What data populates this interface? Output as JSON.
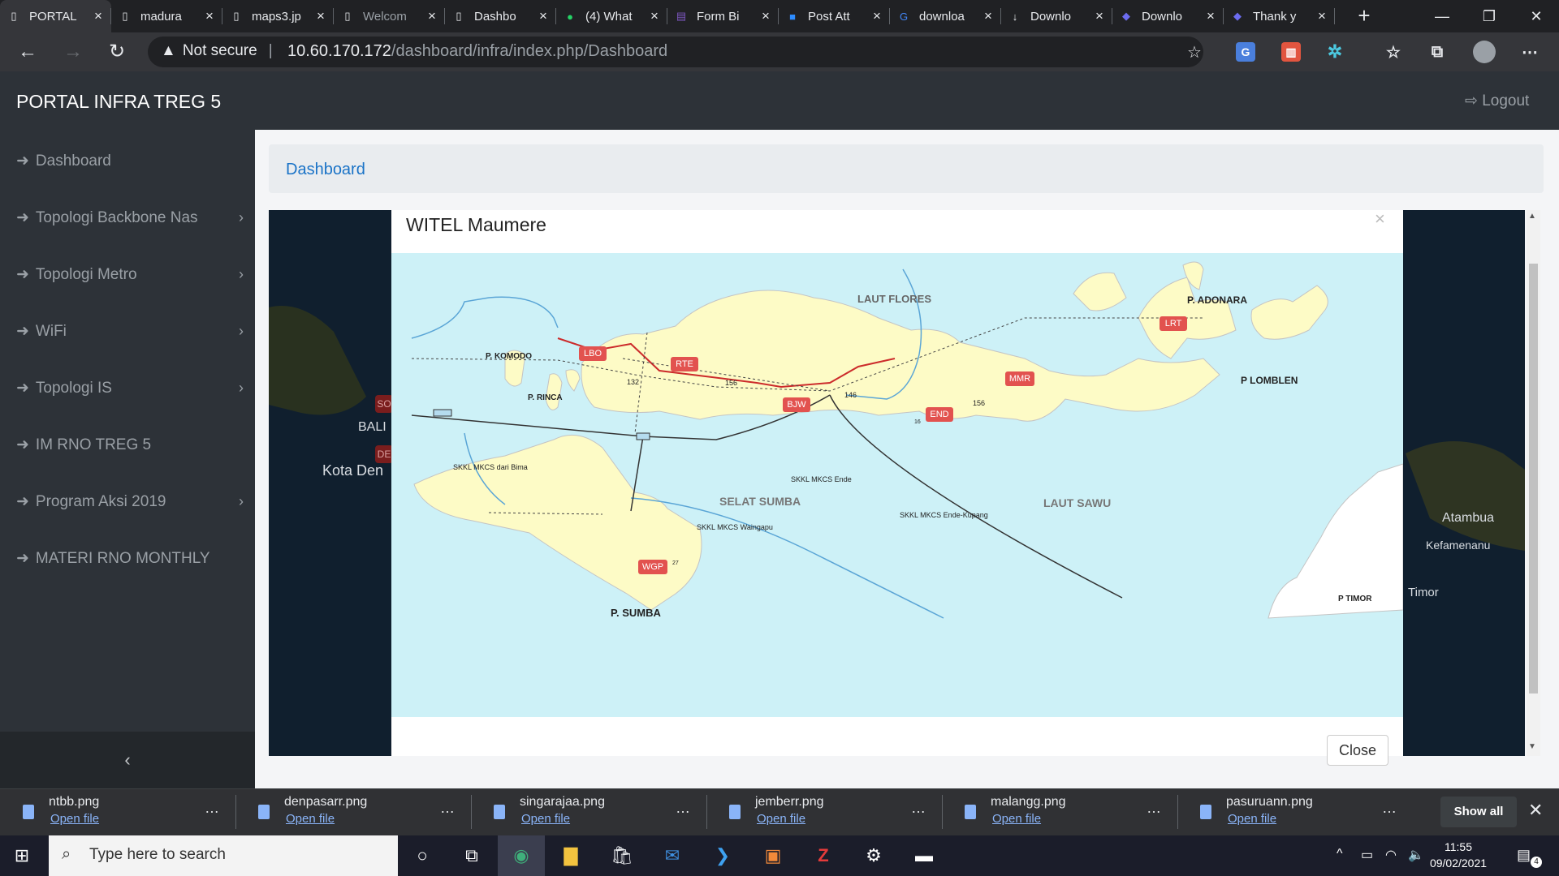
{
  "browser": {
    "tabs": [
      {
        "title": "PORTAL",
        "icon": "page-icon",
        "active": true
      },
      {
        "title": "madura",
        "icon": "page-icon"
      },
      {
        "title": "maps3.jp",
        "icon": "page-icon"
      },
      {
        "title": "Welcom",
        "icon": "page-icon",
        "dim": true
      },
      {
        "title": "Dashbo",
        "icon": "page-icon"
      },
      {
        "title": "(4) What",
        "icon": "whatsapp-icon"
      },
      {
        "title": "Form Bi",
        "icon": "forms-icon"
      },
      {
        "title": "Post Att",
        "icon": "zoom-icon"
      },
      {
        "title": "downloa",
        "icon": "google-icon"
      },
      {
        "title": "Downlo",
        "icon": "download-icon"
      },
      {
        "title": "Downlo",
        "icon": "app-icon"
      },
      {
        "title": "Thank y",
        "icon": "app-icon"
      }
    ],
    "security": "Not secure",
    "url_host": "10.60.170.172",
    "url_path": "/dashboard/infra/index.php/Dashboard"
  },
  "app": {
    "brand": "PORTAL INFRA TREG 5",
    "logout": "Logout",
    "sidebar": [
      {
        "label": "Dashboard",
        "chevron": false
      },
      {
        "label": "Topologi Backbone Nas",
        "chevron": true
      },
      {
        "label": "Topologi Metro",
        "chevron": true
      },
      {
        "label": "WiFi",
        "chevron": true
      },
      {
        "label": "Topologi IS",
        "chevron": true
      },
      {
        "label": "IM RNO TREG 5",
        "chevron": false
      },
      {
        "label": "Program Aksi 2019",
        "chevron": true
      },
      {
        "label": "MATERI RNO MONTHLY",
        "chevron": false
      }
    ],
    "breadcrumb": "Dashboard",
    "bg_labels": [
      "BALI",
      "Kota Den",
      "Atambua",
      "Kefamenanu",
      "Timor",
      "SO",
      "DE"
    ]
  },
  "modal": {
    "title": "WITEL Maumere",
    "close_x": "×",
    "close_button": "Close",
    "map": {
      "seas": [
        "LAUT FLORES",
        "SELAT SUMBA",
        "LAUT SAWU"
      ],
      "islands": [
        "P. KOMODO",
        "P. RINCA",
        "P. ADONARA",
        "P LOMBLEN",
        "P. SUMBA",
        "P TIMOR"
      ],
      "nodes": [
        "LBO",
        "RTE",
        "BJW",
        "END",
        "MMR",
        "LRT",
        "WGP"
      ],
      "distances": [
        "132",
        "156",
        "146",
        "156",
        "16",
        "27"
      ],
      "cables": [
        "SKKL MKCS  dari Bima",
        "SKKL MKCS Ende",
        "SKKL MKCS Waingapu",
        "SKKL MKCS Ende-Kupang"
      ]
    }
  },
  "downloads": {
    "items": [
      {
        "name": "ntbb.png",
        "action": "Open file"
      },
      {
        "name": "denpasarr.png",
        "action": "Open file"
      },
      {
        "name": "singarajaa.png",
        "action": "Open file"
      },
      {
        "name": "jemberr.png",
        "action": "Open file"
      },
      {
        "name": "malangg.png",
        "action": "Open file"
      },
      {
        "name": "pasuruann.png",
        "action": "Open file"
      }
    ],
    "show_all": "Show all"
  },
  "taskbar": {
    "search_placeholder": "Type here to search",
    "time": "11:55",
    "date": "09/02/2021",
    "notification_count": "4"
  }
}
